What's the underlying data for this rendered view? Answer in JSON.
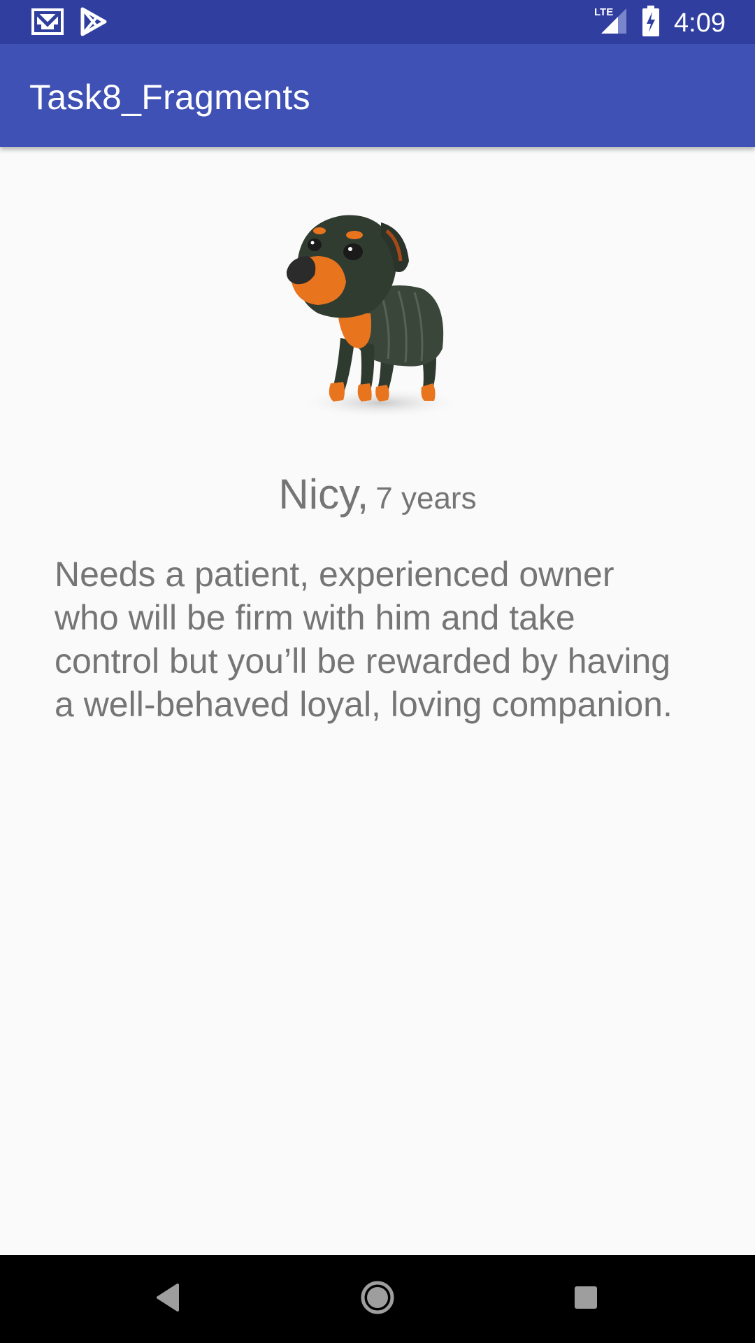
{
  "status_bar": {
    "time": "4:09",
    "network": "LTE",
    "left_icons": [
      "gmail-icon",
      "play-store-icon"
    ],
    "right_icons": [
      "lte-signal-icon",
      "battery-charging-icon"
    ]
  },
  "app_bar": {
    "title": "Task8_Fragments"
  },
  "pet": {
    "name": "Nicy,",
    "age": "7 years",
    "description": "Needs a patient, experienced owner who will be firm with him and take control but you’ll be rewarded by having a well-behaved loyal, loving companion.",
    "image": "dog-photo"
  },
  "nav_bar": {
    "buttons": [
      "back-icon",
      "home-icon",
      "recents-icon"
    ]
  },
  "colors": {
    "status_bar": "#303f9f",
    "app_bar": "#3f51b5",
    "background": "#fafafa",
    "text_secondary": "#757575",
    "nav_bar": "#000000"
  }
}
